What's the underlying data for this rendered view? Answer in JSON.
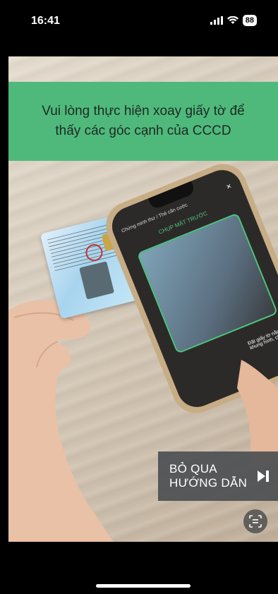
{
  "status_bar": {
    "time": "16:41",
    "battery": "88",
    "icons": [
      "signal-icon",
      "wifi-icon",
      "battery-icon"
    ]
  },
  "banner": {
    "line1": "Vui lòng thực hiện xoay giấy tờ để",
    "line2": "thấy các góc cạnh của CCCD",
    "background": "#4fb97c"
  },
  "phone_screen": {
    "header": "Chứng minh thư / Thẻ căn cước",
    "title": "CHỤP MẶT TRƯỚC",
    "hint": "Đặt giấy tờ nằm vừa khung hình, chụp đủ sáng"
  },
  "skip_button": {
    "line1": "BỎ QUA",
    "line2": "HƯỚNG DẪN",
    "icon": "skip-next-icon"
  },
  "scan_button": {
    "icon": "document-scan-icon"
  }
}
